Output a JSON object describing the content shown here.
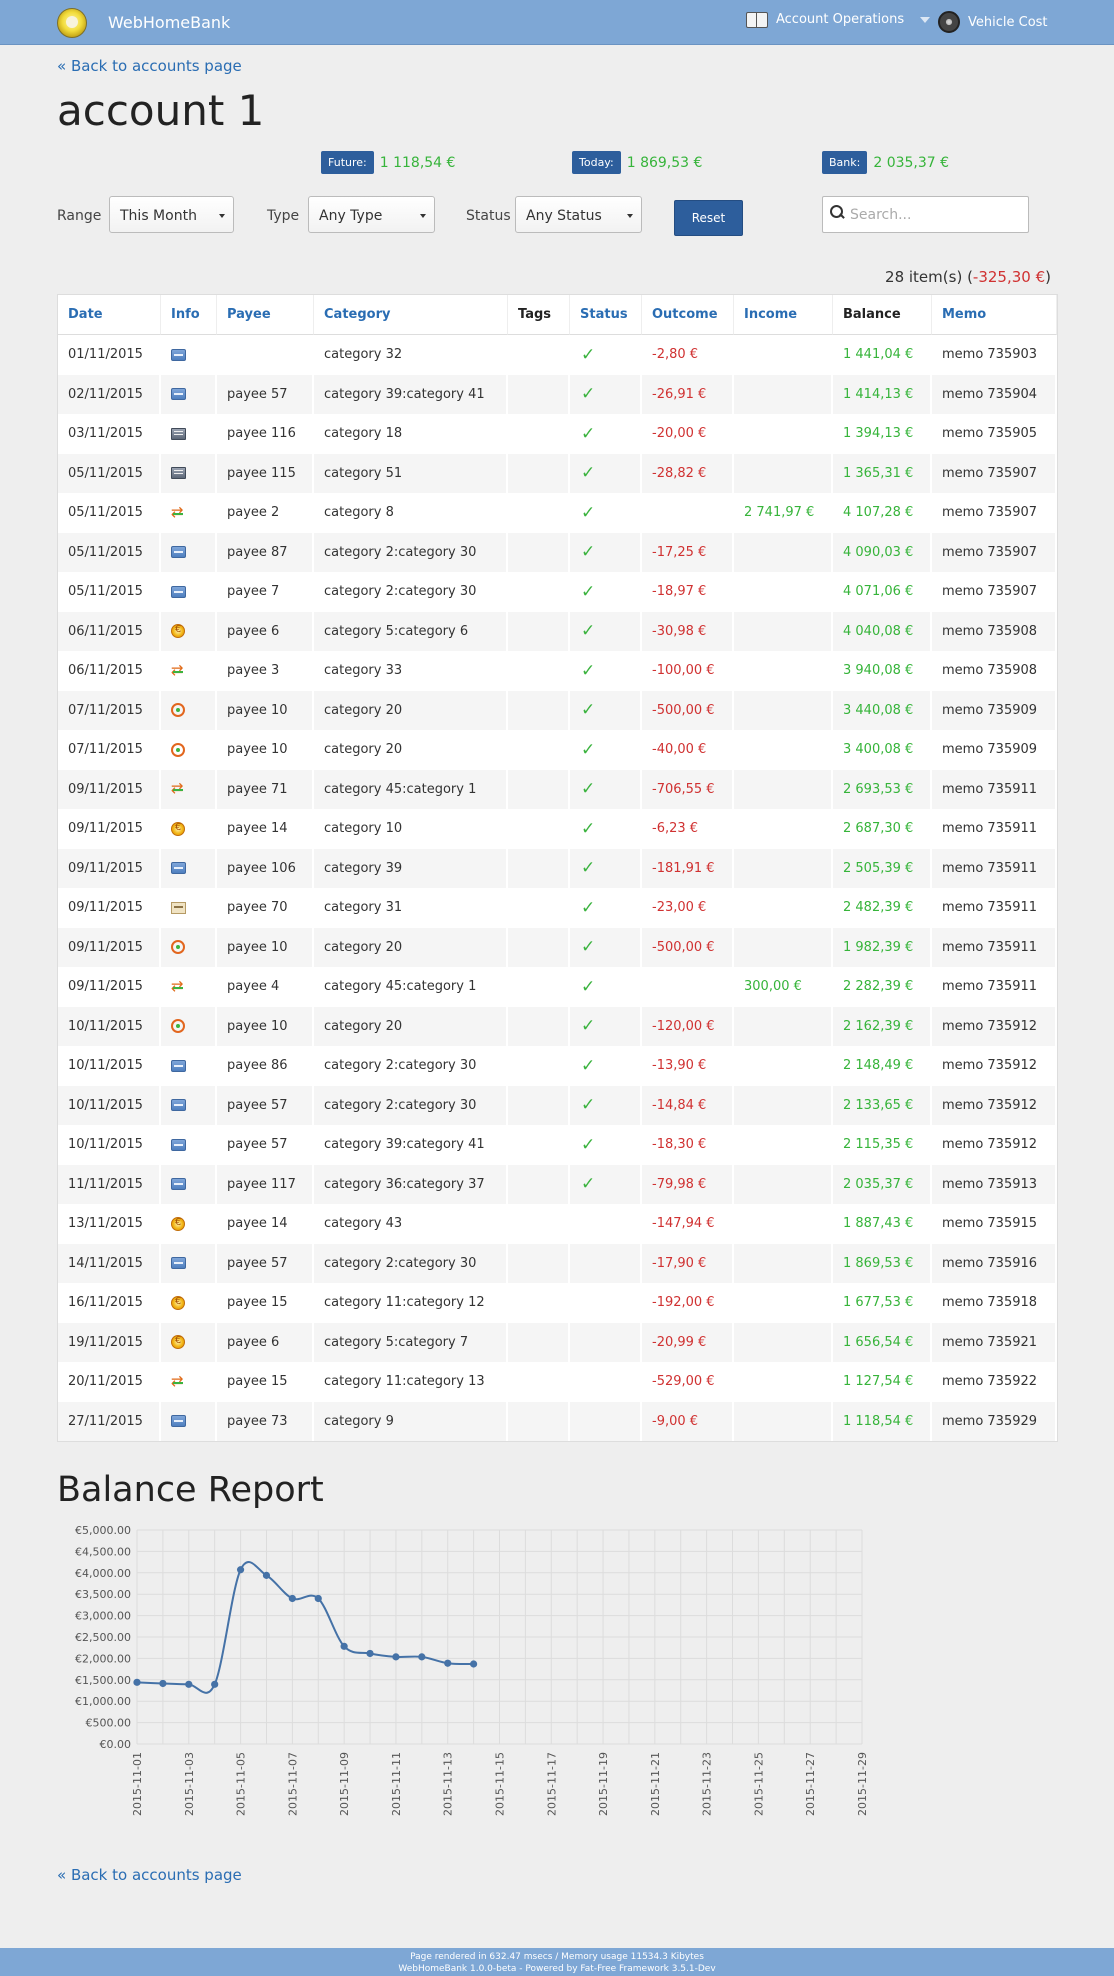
{
  "nav": {
    "brand": "WebHomeBank",
    "account_operations": "Account Operations",
    "vehicle_cost": "Vehicle Cost"
  },
  "back_link": "« Back to accounts page",
  "account_title": "account 1",
  "summary": {
    "future_label": "Future:",
    "future_value": "1 118,54 €",
    "today_label": "Today:",
    "today_value": "1 869,53 €",
    "bank_label": "Bank:",
    "bank_value": "2 035,37 €"
  },
  "filters": {
    "range_label": "Range",
    "range_value": "This Month",
    "type_label": "Type",
    "type_value": "Any Type",
    "status_label": "Status",
    "status_value": "Any Status",
    "reset_label": "Reset",
    "search_placeholder": "Search..."
  },
  "item_count": {
    "prefix": "28 item(s) (",
    "total": "-325,30 €",
    "suffix": ")"
  },
  "table": {
    "columns": [
      "Date",
      "Info",
      "Payee",
      "Category",
      "Tags",
      "Status",
      "Outcome",
      "Income",
      "Balance",
      "Memo"
    ],
    "rows": [
      {
        "date": "01/11/2015",
        "info": "card",
        "payee": "",
        "category": "category 32",
        "reconciled": true,
        "outcome": "-2,80 €",
        "income": "",
        "balance": "1 441,04 €",
        "memo": "memo 735903"
      },
      {
        "date": "02/11/2015",
        "info": "card",
        "payee": "payee 57",
        "category": "category 39:category 41",
        "reconciled": true,
        "outcome": "-26,91 €",
        "income": "",
        "balance": "1 414,13 €",
        "memo": "memo 735904"
      },
      {
        "date": "03/11/2015",
        "info": "check",
        "payee": "payee 116",
        "category": "category 18",
        "reconciled": true,
        "outcome": "-20,00 €",
        "income": "",
        "balance": "1 394,13 €",
        "memo": "memo 735905"
      },
      {
        "date": "05/11/2015",
        "info": "check",
        "payee": "payee 115",
        "category": "category 51",
        "reconciled": true,
        "outcome": "-28,82 €",
        "income": "",
        "balance": "1 365,31 €",
        "memo": "memo 735907"
      },
      {
        "date": "05/11/2015",
        "info": "transfer",
        "payee": "payee 2",
        "category": "category 8",
        "reconciled": true,
        "outcome": "",
        "income": "2 741,97 €",
        "balance": "4 107,28 €",
        "memo": "memo 735907"
      },
      {
        "date": "05/11/2015",
        "info": "card",
        "payee": "payee 87",
        "category": "category 2:category 30",
        "reconciled": true,
        "outcome": "-17,25 €",
        "income": "",
        "balance": "4 090,03 €",
        "memo": "memo 735907"
      },
      {
        "date": "05/11/2015",
        "info": "card",
        "payee": "payee 7",
        "category": "category 2:category 30",
        "reconciled": true,
        "outcome": "-18,97 €",
        "income": "",
        "balance": "4 071,06 €",
        "memo": "memo 735907"
      },
      {
        "date": "06/11/2015",
        "info": "direct-debit",
        "payee": "payee 6",
        "category": "category 5:category 6",
        "reconciled": true,
        "outcome": "-30,98 €",
        "income": "",
        "balance": "4 040,08 €",
        "memo": "memo 735908"
      },
      {
        "date": "06/11/2015",
        "info": "transfer",
        "payee": "payee 3",
        "category": "category 33",
        "reconciled": true,
        "outcome": "-100,00 €",
        "income": "",
        "balance": "3 940,08 €",
        "memo": "memo 735908"
      },
      {
        "date": "07/11/2015",
        "info": "standing-order",
        "payee": "payee 10",
        "category": "category 20",
        "reconciled": true,
        "outcome": "-500,00 €",
        "income": "",
        "balance": "3 440,08 €",
        "memo": "memo 735909"
      },
      {
        "date": "07/11/2015",
        "info": "standing-order",
        "payee": "payee 10",
        "category": "category 20",
        "reconciled": true,
        "outcome": "-40,00 €",
        "income": "",
        "balance": "3 400,08 €",
        "memo": "memo 735909"
      },
      {
        "date": "09/11/2015",
        "info": "transfer",
        "payee": "payee 71",
        "category": "category 45:category 1",
        "reconciled": true,
        "outcome": "-706,55 €",
        "income": "",
        "balance": "2 693,53 €",
        "memo": "memo 735911"
      },
      {
        "date": "09/11/2015",
        "info": "direct-debit",
        "payee": "payee 14",
        "category": "category 10",
        "reconciled": true,
        "outcome": "-6,23 €",
        "income": "",
        "balance": "2 687,30 €",
        "memo": "memo 735911"
      },
      {
        "date": "09/11/2015",
        "info": "card",
        "payee": "payee 106",
        "category": "category 39",
        "reconciled": true,
        "outcome": "-181,91 €",
        "income": "",
        "balance": "2 505,39 €",
        "memo": "memo 735911"
      },
      {
        "date": "09/11/2015",
        "info": "deposit",
        "payee": "payee 70",
        "category": "category 31",
        "reconciled": true,
        "outcome": "-23,00 €",
        "income": "",
        "balance": "2 482,39 €",
        "memo": "memo 735911"
      },
      {
        "date": "09/11/2015",
        "info": "standing-order",
        "payee": "payee 10",
        "category": "category 20",
        "reconciled": true,
        "outcome": "-500,00 €",
        "income": "",
        "balance": "1 982,39 €",
        "memo": "memo 735911"
      },
      {
        "date": "09/11/2015",
        "info": "transfer",
        "payee": "payee 4",
        "category": "category 45:category 1",
        "reconciled": true,
        "outcome": "",
        "income": "300,00 €",
        "balance": "2 282,39 €",
        "memo": "memo 735911"
      },
      {
        "date": "10/11/2015",
        "info": "standing-order",
        "payee": "payee 10",
        "category": "category 20",
        "reconciled": true,
        "outcome": "-120,00 €",
        "income": "",
        "balance": "2 162,39 €",
        "memo": "memo 735912"
      },
      {
        "date": "10/11/2015",
        "info": "card",
        "payee": "payee 86",
        "category": "category 2:category 30",
        "reconciled": true,
        "outcome": "-13,90 €",
        "income": "",
        "balance": "2 148,49 €",
        "memo": "memo 735912"
      },
      {
        "date": "10/11/2015",
        "info": "card",
        "payee": "payee 57",
        "category": "category 2:category 30",
        "reconciled": true,
        "outcome": "-14,84 €",
        "income": "",
        "balance": "2 133,65 €",
        "memo": "memo 735912"
      },
      {
        "date": "10/11/2015",
        "info": "card",
        "payee": "payee 57",
        "category": "category 39:category 41",
        "reconciled": true,
        "outcome": "-18,30 €",
        "income": "",
        "balance": "2 115,35 €",
        "memo": "memo 735912"
      },
      {
        "date": "11/11/2015",
        "info": "card",
        "payee": "payee 117",
        "category": "category 36:category 37",
        "reconciled": true,
        "outcome": "-79,98 €",
        "income": "",
        "balance": "2 035,37 €",
        "memo": "memo 735913"
      },
      {
        "date": "13/11/2015",
        "info": "direct-debit",
        "payee": "payee 14",
        "category": "category 43",
        "reconciled": false,
        "outcome": "-147,94 €",
        "income": "",
        "balance": "1 887,43 €",
        "memo": "memo 735915"
      },
      {
        "date": "14/11/2015",
        "info": "card",
        "payee": "payee 57",
        "category": "category 2:category 30",
        "reconciled": false,
        "outcome": "-17,90 €",
        "income": "",
        "balance": "1 869,53 €",
        "memo": "memo 735916"
      },
      {
        "date": "16/11/2015",
        "info": "direct-debit",
        "payee": "payee 15",
        "category": "category 11:category 12",
        "reconciled": false,
        "outcome": "-192,00 €",
        "income": "",
        "balance": "1 677,53 €",
        "memo": "memo 735918"
      },
      {
        "date": "19/11/2015",
        "info": "direct-debit",
        "payee": "payee 6",
        "category": "category 5:category 7",
        "reconciled": false,
        "outcome": "-20,99 €",
        "income": "",
        "balance": "1 656,54 €",
        "memo": "memo 735921"
      },
      {
        "date": "20/11/2015",
        "info": "transfer",
        "payee": "payee 15",
        "category": "category 11:category 13",
        "reconciled": false,
        "outcome": "-529,00 €",
        "income": "",
        "balance": "1 127,54 €",
        "memo": "memo 735922"
      },
      {
        "date": "27/11/2015",
        "info": "card",
        "payee": "payee 73",
        "category": "category 9",
        "reconciled": false,
        "outcome": "-9,00 €",
        "income": "",
        "balance": "1 118,54 €",
        "memo": "memo 735929"
      }
    ]
  },
  "report_title": "Balance Report",
  "chart_data": {
    "type": "line",
    "title": "",
    "xlabel": "",
    "ylabel": "",
    "x_ticks": [
      "2015-11-01",
      "2015-11-03",
      "2015-11-05",
      "2015-11-07",
      "2015-11-09",
      "2015-11-11",
      "2015-11-13",
      "2015-11-15",
      "2015-11-17",
      "2015-11-19",
      "2015-11-21",
      "2015-11-23",
      "2015-11-25",
      "2015-11-27",
      "2015-11-29"
    ],
    "y_ticks": [
      "€0.00",
      "€500.00",
      "€1,000.00",
      "€1,500.00",
      "€2,000.00",
      "€2,500.00",
      "€3,000.00",
      "€3,500.00",
      "€4,000.00",
      "€4,500.00",
      "€5,000.00"
    ],
    "xlim": [
      "2015-11-01",
      "2015-11-29"
    ],
    "ylim": [
      0,
      5000
    ],
    "grid": true,
    "series": [
      {
        "color": "#4572a7",
        "points": [
          {
            "x": "2015-11-01",
            "y": 1441.04
          },
          {
            "x": "2015-11-02",
            "y": 1414.13
          },
          {
            "x": "2015-11-03",
            "y": 1394.13
          },
          {
            "x": "2015-11-04",
            "y": 1394.13
          },
          {
            "x": "2015-11-05",
            "y": 4071.06
          },
          {
            "x": "2015-11-06",
            "y": 3940.08
          },
          {
            "x": "2015-11-07",
            "y": 3400.08
          },
          {
            "x": "2015-11-08",
            "y": 3400.08
          },
          {
            "x": "2015-11-09",
            "y": 2282.39
          },
          {
            "x": "2015-11-10",
            "y": 2115.35
          },
          {
            "x": "2015-11-11",
            "y": 2035.37
          },
          {
            "x": "2015-11-12",
            "y": 2035.37
          },
          {
            "x": "2015-11-13",
            "y": 1887.43
          },
          {
            "x": "2015-11-14",
            "y": 1869.53
          }
        ]
      }
    ]
  },
  "footer": {
    "line1": "Page rendered in 632.47 msecs / Memory usage 11534.3 Kibytes",
    "line2": "WebHomeBank 1.0.0-beta - Powered by Fat-Free Framework 3.5.1-Dev"
  }
}
